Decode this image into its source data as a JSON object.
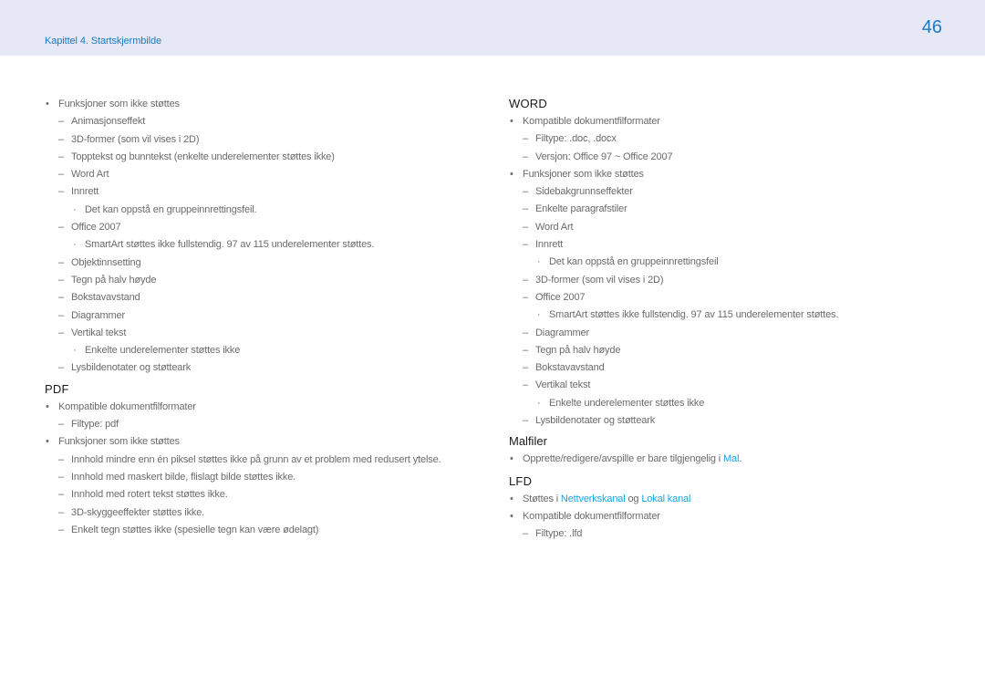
{
  "header": {
    "chapter": "Kapittel 4. Startskjermbilde",
    "page_number": "46"
  },
  "left_column": {
    "powerpoint_items": [
      {
        "level": 1,
        "text": "Funksjoner som ikke støttes"
      },
      {
        "level": 2,
        "text": "Animasjonseffekt"
      },
      {
        "level": 2,
        "text": "3D-former (som vil vises i 2D)"
      },
      {
        "level": 2,
        "text": "Topptekst og bunntekst (enkelte underelementer støttes ikke)"
      },
      {
        "level": 2,
        "text": "Word Art"
      },
      {
        "level": 2,
        "text": "Innrett"
      },
      {
        "level": 3,
        "text": "Det kan oppstå en gruppeinnrettingsfeil."
      },
      {
        "level": 2,
        "text": "Office 2007"
      },
      {
        "level": 3,
        "text": "SmartArt støttes ikke fullstendig. 97 av 115 underelementer støttes."
      },
      {
        "level": 2,
        "text": "Objektinnsetting"
      },
      {
        "level": 2,
        "text": "Tegn på halv høyde"
      },
      {
        "level": 2,
        "text": "Bokstavavstand"
      },
      {
        "level": 2,
        "text": "Diagrammer"
      },
      {
        "level": 2,
        "text": "Vertikal tekst"
      },
      {
        "level": 3,
        "text": "Enkelte underelementer støttes ikke"
      },
      {
        "level": 2,
        "text": "Lysbildenotater og støtteark"
      }
    ],
    "pdf": {
      "title": "PDF",
      "items": [
        {
          "level": 1,
          "text": "Kompatible dokumentfilformater"
        },
        {
          "level": 2,
          "text": "Filtype: pdf"
        },
        {
          "level": 1,
          "text": "Funksjoner som ikke støttes"
        },
        {
          "level": 2,
          "text": "Innhold mindre enn én piksel støttes ikke på grunn av et problem med redusert ytelse."
        },
        {
          "level": 2,
          "text": "Innhold med maskert bilde, flislagt bilde støttes ikke."
        },
        {
          "level": 2,
          "text": "Innhold med rotert tekst støttes ikke."
        },
        {
          "level": 2,
          "text": "3D-skyggeeffekter støttes ikke."
        },
        {
          "level": 2,
          "text": "Enkelt tegn støttes ikke (spesielle tegn kan være ødelagt)"
        }
      ]
    }
  },
  "right_column": {
    "word": {
      "title": "WORD",
      "items": [
        {
          "level": 1,
          "text": "Kompatible dokumentfilformater"
        },
        {
          "level": 2,
          "text": "Filtype: .doc, .docx"
        },
        {
          "level": 2,
          "text": "Versjon: Office 97 ~ Office 2007"
        },
        {
          "level": 1,
          "text": "Funksjoner som ikke støttes"
        },
        {
          "level": 2,
          "text": "Sidebakgrunnseffekter"
        },
        {
          "level": 2,
          "text": "Enkelte paragrafstiler"
        },
        {
          "level": 2,
          "text": "Word Art"
        },
        {
          "level": 2,
          "text": "Innrett"
        },
        {
          "level": 3,
          "text": "Det kan oppstå en gruppeinnrettingsfeil"
        },
        {
          "level": 2,
          "text": "3D-former (som vil vises i 2D)"
        },
        {
          "level": 2,
          "text": "Office 2007"
        },
        {
          "level": 3,
          "text": "SmartArt støttes ikke fullstendig. 97 av 115 underelementer støttes."
        },
        {
          "level": 2,
          "text": "Diagrammer"
        },
        {
          "level": 2,
          "text": "Tegn på halv høyde"
        },
        {
          "level": 2,
          "text": "Bokstavavstand"
        },
        {
          "level": 2,
          "text": "Vertikal tekst"
        },
        {
          "level": 3,
          "text": "Enkelte underelementer støttes ikke"
        },
        {
          "level": 2,
          "text": "Lysbildenotater og støtteark"
        }
      ]
    },
    "templates": {
      "title": "Malfiler",
      "item_prefix": "Opprette/redigere/avspille er bare tilgjengelig i ",
      "item_link": "Mal",
      "item_suffix": "."
    },
    "lfd": {
      "title": "LFD",
      "supported_prefix": "Støttes i ",
      "supported_link1": "Nettverkskanal",
      "supported_middle": " og ",
      "supported_link2": "Lokal kanal",
      "formats_label": "Kompatible dokumentfilformater",
      "filetype": "Filtype: .lfd"
    }
  },
  "markers": {
    "level1": "•",
    "level2": "–",
    "level3": "·"
  },
  "colors": {
    "accent": "#1a7ac4",
    "link": "#1ba5e0",
    "header_bg": "#e6e8f6",
    "body_text": "#6b6b6b"
  }
}
